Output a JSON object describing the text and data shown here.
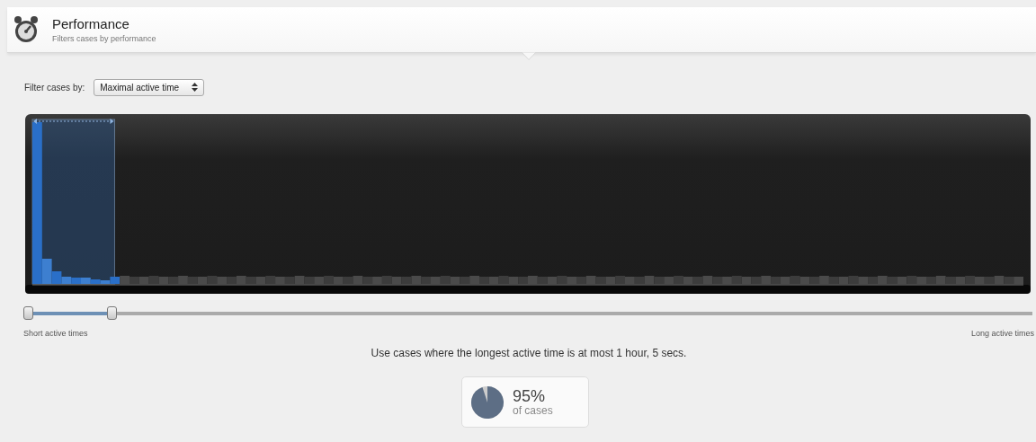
{
  "header": {
    "title": "Performance",
    "subtitle": "Filters cases by performance"
  },
  "filter": {
    "label": "Filter cases by:",
    "value": "Maximal active time"
  },
  "range_slider": {
    "handles": [
      {
        "level": 0
      },
      {
        "level": 0.083
      }
    ],
    "min_label": "Short active times",
    "max_label": "Long active times"
  },
  "summary": "Use cases where the longest active time is at most 1 hour, 5 secs.",
  "result": {
    "percent": "95%",
    "caption": "of cases"
  }
}
